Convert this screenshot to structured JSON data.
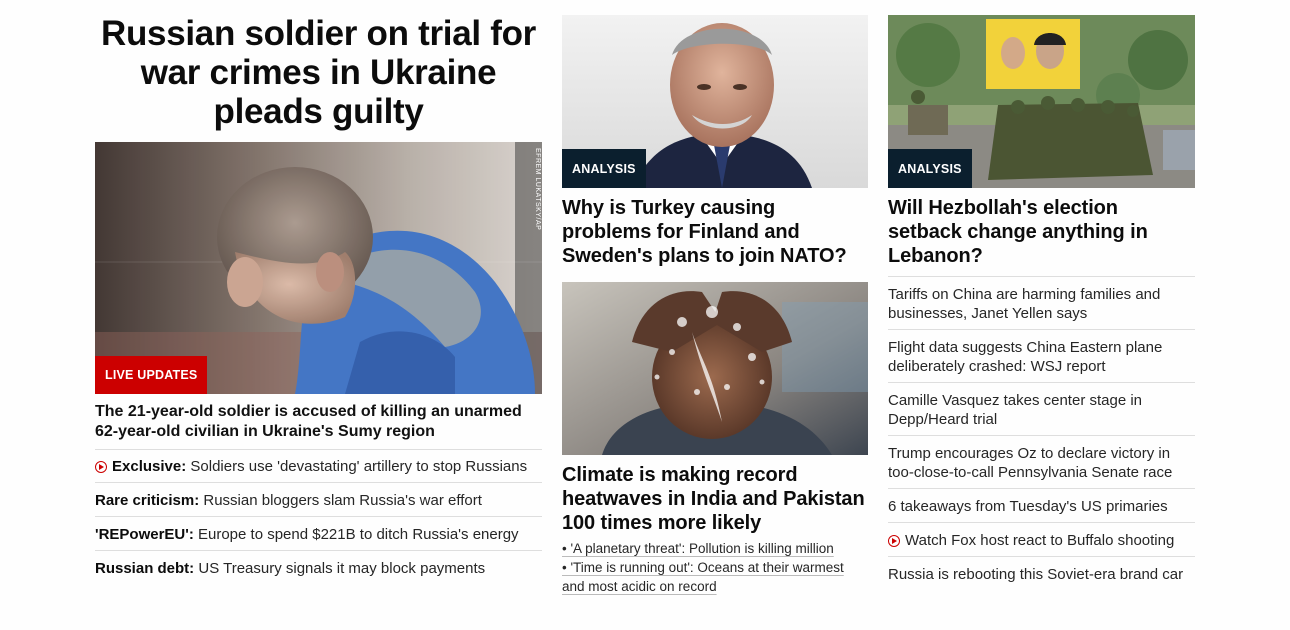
{
  "lead": {
    "headline": "Russian soldier on trial for war crimes in Ukraine pleads guilty",
    "image_alt": "Russian soldier in courtroom glass booth",
    "photo_credit": "EFREM LUKATSKY/AP",
    "badge": "LIVE UPDATES",
    "summary": "The 21-year-old soldier is accused of killing an unarmed 62-year-old civilian in Ukraine's Sumy region",
    "related": [
      {
        "prefix": "Exclusive:",
        "text": " Soldiers use 'devastating' artillery to stop Russians",
        "video": true
      },
      {
        "prefix": "Rare criticism:",
        "text": " Russian bloggers slam Russia's war effort",
        "video": false
      },
      {
        "prefix": "'REPowerEU':",
        "text": " Europe to spend $221B to ditch Russia's energy",
        "video": false
      },
      {
        "prefix": "Russian debt:",
        "text": " US Treasury signals it may block payments",
        "video": false
      }
    ]
  },
  "col2": {
    "card1": {
      "badge": "ANALYSIS",
      "title": "Why is Turkey causing problems for Finland and Sweden's plans to join NATO?"
    },
    "card2": {
      "title": "Climate is making record heatwaves in India and Pakistan 100 times more likely",
      "links": [
        "• 'A planetary threat': Pollution is killing million",
        "• 'Time is running out': Oceans at their warmest and most acidic on record"
      ]
    }
  },
  "col3": {
    "card1": {
      "badge": "ANALYSIS",
      "title": "Will Hezbollah's election setback change anything in Lebanon?"
    },
    "headlines": [
      {
        "text": "Tariffs on China are harming families and businesses, Janet Yellen says",
        "video": false
      },
      {
        "text": "Flight data suggests China Eastern plane deliberately crashed: WSJ report",
        "video": false
      },
      {
        "text": "Camille Vasquez takes center stage in Depp/Heard trial",
        "video": false
      },
      {
        "text": "Trump encourages Oz to declare victory in too-close-to-call Pennsylvania Senate race",
        "video": false
      },
      {
        "text": "6 takeaways from Tuesday's US primaries",
        "video": false
      },
      {
        "text": "Watch Fox host react to Buffalo shooting",
        "video": true
      },
      {
        "text": "Russia is rebooting this Soviet-era brand car",
        "video": false
      }
    ]
  },
  "colors": {
    "live_red": "#cc0000",
    "analysis_navy": "#0b1f2e",
    "divider": "#dedede",
    "text": "#0c0c0c"
  }
}
